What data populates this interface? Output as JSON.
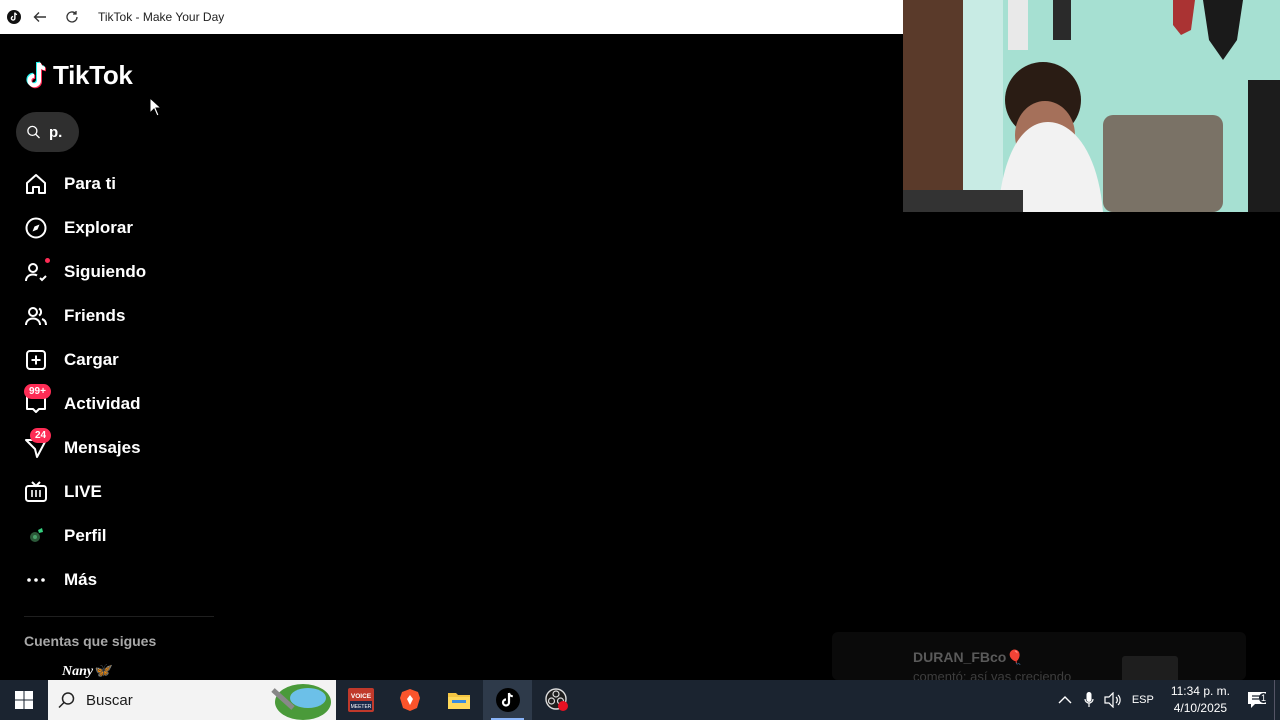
{
  "window": {
    "title": "TikTok - Make Your Day"
  },
  "logo": {
    "text": "TikTok"
  },
  "search": {
    "value": "p."
  },
  "nav": [
    {
      "label": "Para ti",
      "icon": "home-icon"
    },
    {
      "label": "Explorar",
      "icon": "compass-icon"
    },
    {
      "label": "Siguiendo",
      "icon": "following-icon"
    },
    {
      "label": "Friends",
      "icon": "friends-icon"
    },
    {
      "label": "Cargar",
      "icon": "upload-icon"
    },
    {
      "label": "Actividad",
      "icon": "activity-icon",
      "badge": "99+"
    },
    {
      "label": "Mensajes",
      "icon": "send-icon",
      "badge": "24"
    },
    {
      "label": "LIVE",
      "icon": "live-tv-icon"
    },
    {
      "label": "Perfil",
      "icon": "profile-avatar"
    },
    {
      "label": "Más",
      "icon": "more-icon"
    }
  ],
  "following": {
    "title": "Cuentas que sigues",
    "first_name": "Nany🦋"
  },
  "notification": {
    "user": "DURAN_FBco🎈",
    "message": "comentó: así vas creciendo"
  },
  "taskbar": {
    "search_placeholder": "Buscar",
    "apps": [
      "voicemeeter-icon",
      "brave-browser-icon",
      "file-explorer-icon",
      "tiktok-icon",
      "obs-recording-icon"
    ],
    "language": "ESP",
    "time": "11:34 p. m.",
    "date": "4/10/2025",
    "notification_count": "1"
  },
  "colors": {
    "accent": "#fe2c55",
    "background": "#000000",
    "taskbar": "#1b2430"
  }
}
